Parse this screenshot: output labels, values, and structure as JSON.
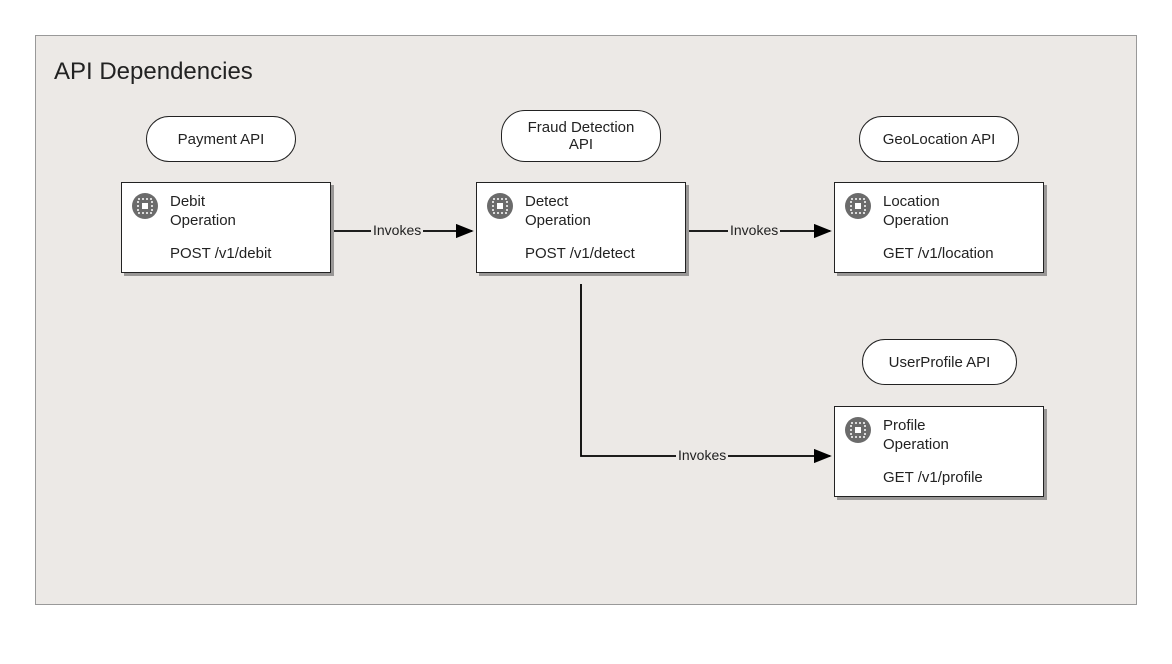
{
  "title": "API Dependencies",
  "apis": {
    "payment": {
      "label": "Payment API"
    },
    "fraud": {
      "label": "Fraud Detection\nAPI"
    },
    "geo": {
      "label": "GeoLocation API"
    },
    "user": {
      "label": "UserProfile API"
    }
  },
  "operations": {
    "debit": {
      "title": "Debit\nOperation",
      "endpoint": "POST /v1/debit"
    },
    "detect": {
      "title": "Detect\nOperation",
      "endpoint": "POST /v1/detect"
    },
    "location": {
      "title": "Location\nOperation",
      "endpoint": "GET /v1/location"
    },
    "profile": {
      "title": "Profile\nOperation",
      "endpoint": "GET /v1/profile"
    }
  },
  "edges": {
    "e1": {
      "label": "Invokes"
    },
    "e2": {
      "label": "Invokes"
    },
    "e3": {
      "label": "Invokes"
    }
  }
}
